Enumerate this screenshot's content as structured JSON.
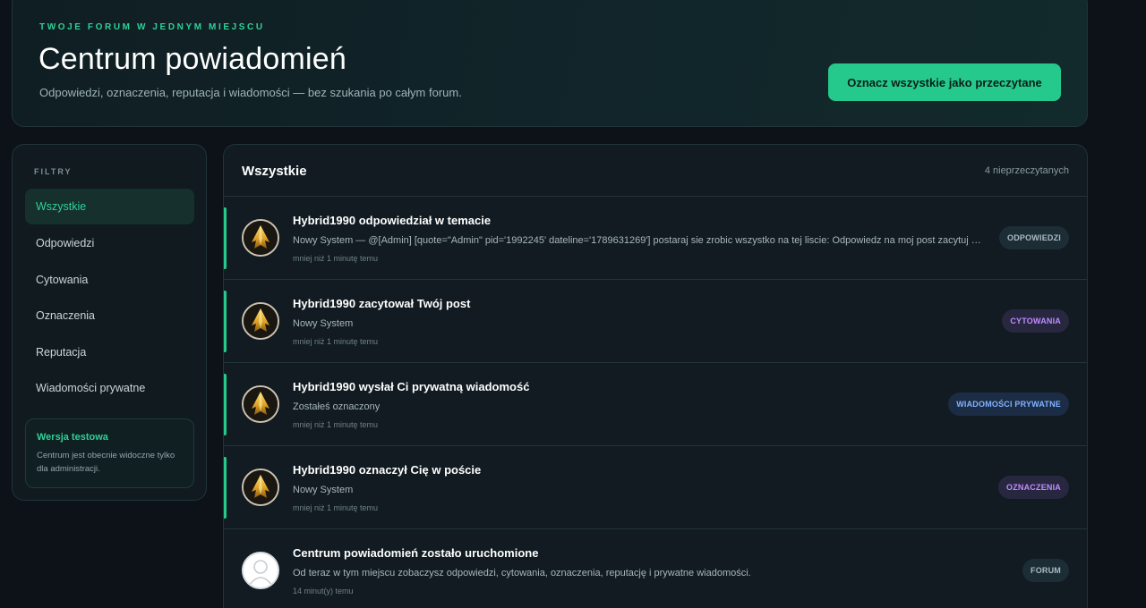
{
  "header": {
    "kicker": "TWOJE FORUM W JEDNYM MIEJSCU",
    "title": "Centrum powiadomień",
    "subtitle": "Odpowiedzi, oznaczenia, reputacja i wiadomości — bez szukania po całym forum.",
    "mark_all_label": "Oznacz wszystkie jako przeczytane"
  },
  "sidebar": {
    "heading": "FILTRY",
    "items": [
      {
        "label": "Wszystkie",
        "active": true
      },
      {
        "label": "Odpowiedzi"
      },
      {
        "label": "Cytowania"
      },
      {
        "label": "Oznaczenia"
      },
      {
        "label": "Reputacja"
      },
      {
        "label": "Wiadomości prywatne"
      }
    ],
    "beta": {
      "title": "Wersja testowa",
      "text": "Centrum jest obecnie widoczne tylko dla administracji."
    }
  },
  "main": {
    "title": "Wszystkie",
    "unread": "4 nieprzeczytanych",
    "notifications": [
      {
        "title": "Hybrid1990 odpowiedział w temacie",
        "body": "Nowy System — @[Admin] [quote=\"Admin\" pid='1992245' dateline='1789631269'] postaraj sie zrobic wszystko na tej liscie: Odpowiedz na moj post zacytuj mnie oznacz mnie daj reputacje wyslij prywatna wiadomosc",
        "time": "mniej niż 1 minutę temu",
        "badge": "ODPOWIEDZI",
        "badge_color": "#a9bcc2",
        "badge_bg": "#1d2d35",
        "unread": true,
        "avatar": "gold-emblem-avatar"
      },
      {
        "title": "Hybrid1990 zacytował Twój post",
        "body": "Nowy System",
        "time": "mniej niż 1 minutę temu",
        "badge": "CYTOWANIA",
        "badge_color": "#c08cff",
        "badge_bg": "#272840",
        "unread": true,
        "avatar": "gold-emblem-avatar"
      },
      {
        "title": "Hybrid1990 wysłał Ci prywatną wiadomość",
        "body": "Zostałeś oznaczony",
        "time": "mniej niż 1 minutę temu",
        "badge": "WIADOMOŚCI PRYWATNE",
        "badge_color": "#7fb4ff",
        "badge_bg": "#1d2c45",
        "unread": true,
        "avatar": "gold-emblem-avatar"
      },
      {
        "title": "Hybrid1990 oznaczył Cię w poście",
        "body": "Nowy System",
        "time": "mniej niż 1 minutę temu",
        "badge": "OZNACZENIA",
        "badge_color": "#c08cff",
        "badge_bg": "#272840",
        "unread": true,
        "avatar": "gold-emblem-avatar"
      },
      {
        "title": "Centrum powiadomień zostało uruchomione",
        "body": "Od teraz w tym miejscu zobaczysz odpowiedzi, cytowania, oznaczenia, reputację i prywatne wiadomości.",
        "time": "14 minut(y) temu",
        "badge": "FORUM",
        "badge_color": "#a9bcc2",
        "badge_bg": "#1d2d35",
        "unread": false,
        "avatar": "default-user-avatar"
      }
    ]
  }
}
